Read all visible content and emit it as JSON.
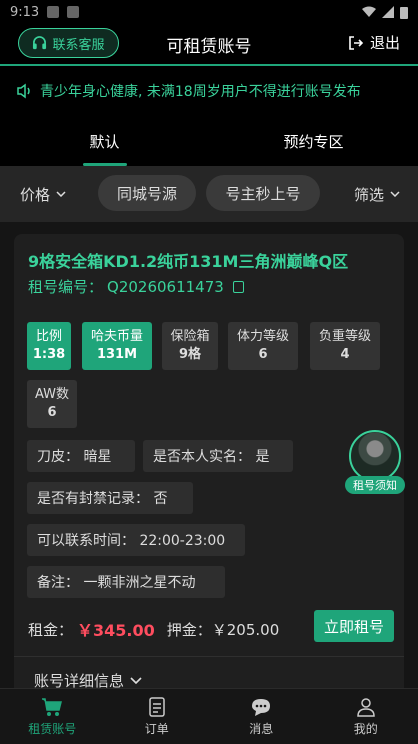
{
  "status_bar": {
    "time": "9:13"
  },
  "header": {
    "customer_service_label": "联系客服",
    "title": "可租赁账号",
    "logout_label": "退出"
  },
  "notice": {
    "text": "青少年身心健康, 未满18周岁用户不得进行账号发布"
  },
  "tabs": [
    {
      "label": "默认",
      "active": true
    },
    {
      "label": "预约专区",
      "active": false
    }
  ],
  "filters": {
    "price_label": "价格",
    "pills": [
      "同城号源",
      "号主秒上号"
    ],
    "screen_label": "筛选"
  },
  "listing": {
    "title": "9格安全箱KD1.2纯币131M三角洲巅峰Q区",
    "rent_no_label": "租号编号：",
    "rent_no": "Q20260611473",
    "tags": [
      {
        "label": "比例",
        "value": "1:38",
        "highlight": true
      },
      {
        "label": "哈夫币量",
        "value": "131M",
        "highlight": true
      },
      {
        "label": "保险箱",
        "value": "9格",
        "highlight": false
      },
      {
        "label": "体力等级",
        "value": "6",
        "highlight": false
      },
      {
        "label": "负重等级",
        "value": "4",
        "highlight": false
      },
      {
        "label": "AW数",
        "value": "6",
        "highlight": false
      }
    ],
    "info": {
      "skin": "刀皮：  暗星",
      "real_name": "是否本人实名：  是",
      "banned": "是否有封禁记录：  否",
      "contact_time": "可以联系时间：  22:00-23:00",
      "remark": "备注：  一颗非洲之星不动"
    },
    "avatar_label": "租号须知",
    "rent_label": "租金：",
    "rent_price": "￥345.00",
    "deposit": "押金：￥205.00",
    "rent_button": "立即租号",
    "detail_label": "账号详细信息"
  },
  "bottom_nav": [
    {
      "label": "租赁账号",
      "active": true
    },
    {
      "label": "订单",
      "active": false
    },
    {
      "label": "消息",
      "active": false
    },
    {
      "label": "我的",
      "active": false
    }
  ],
  "colors": {
    "accent": "#1fa57a",
    "accent_text": "#3ad29b",
    "price": "#ff4d5f"
  }
}
